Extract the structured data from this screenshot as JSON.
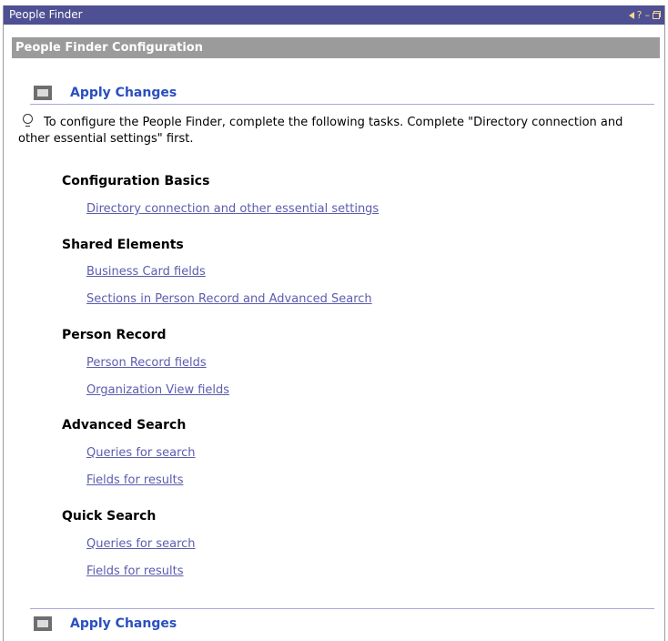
{
  "window": {
    "title": "People Finder",
    "controls": [
      "?",
      "–"
    ]
  },
  "section": {
    "title": "People Finder Configuration"
  },
  "apply": {
    "label": "Apply Changes"
  },
  "intro": {
    "text": "To configure the People Finder, complete the following tasks. Complete \"Directory connection and other essential settings\" first."
  },
  "groups": [
    {
      "heading": "Configuration Basics",
      "links": [
        "Directory connection and other essential settings"
      ]
    },
    {
      "heading": "Shared Elements",
      "links": [
        "Business Card fields",
        "Sections in Person Record and Advanced Search"
      ]
    },
    {
      "heading": "Person Record",
      "links": [
        "Person Record fields",
        "Organization View fields"
      ]
    },
    {
      "heading": "Advanced Search",
      "links": [
        "Queries for search",
        "Fields for results"
      ]
    },
    {
      "heading": "Quick Search",
      "links": [
        "Queries for search",
        "Fields for results"
      ]
    }
  ],
  "colors": {
    "titlebar": "#4f4f93",
    "section_header": "#9b9b9b",
    "apply_text": "#2a4fc0",
    "link": "#5c5cb0"
  }
}
